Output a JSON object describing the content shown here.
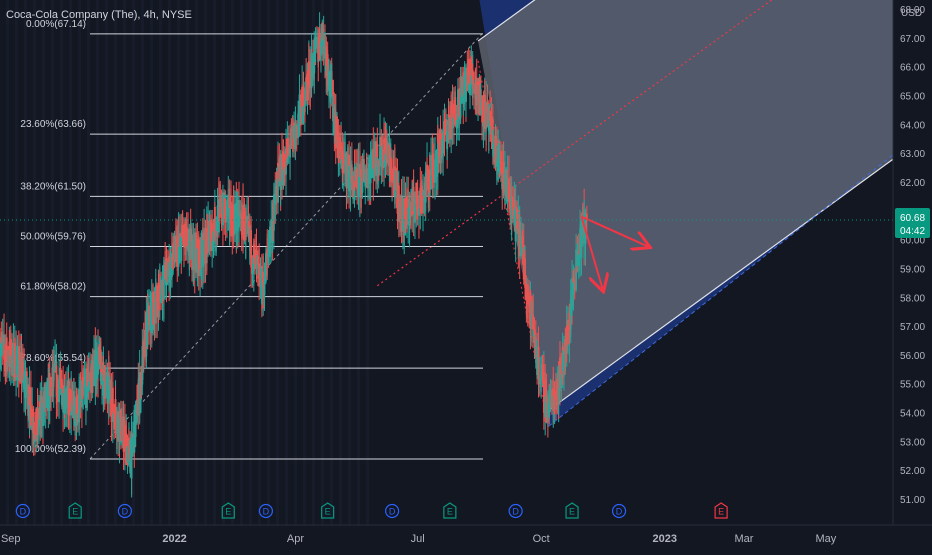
{
  "header": {
    "symbol_title": "Coca-Cola Company (The), 4h, NYSE",
    "currency": "USD"
  },
  "price_badge": {
    "price": "60.68",
    "countdown": "04:42",
    "color": "#089981"
  },
  "colors": {
    "background": "#131722",
    "candle_up": "#26a69a",
    "candle_down": "#ef5350",
    "fib_line": "#d1d4dc",
    "channel_outer": "#1e3a8a",
    "channel_inner": "#5d606b",
    "red_arrow": "#f23645",
    "event_dividend": "#2962ff",
    "event_earnings": "#089981",
    "event_earnings_future": "#f23645"
  },
  "chart_data": {
    "type": "candlestick",
    "y_axis": {
      "range": [
        50.8,
        68.7
      ],
      "ticks": [
        "51.00",
        "52.00",
        "53.00",
        "54.00",
        "55.00",
        "56.00",
        "57.00",
        "58.00",
        "59.00",
        "60.00",
        "61.00",
        "62.00",
        "63.00",
        "64.00",
        "65.00",
        "66.00",
        "67.00",
        "68.00"
      ]
    },
    "x_axis": {
      "range": [
        "2021-08-24",
        "2023-06-20"
      ],
      "ticks": [
        {
          "label": "Sep",
          "date": "2021-09-01"
        },
        {
          "label": "2022",
          "date": "2022-01-01"
        },
        {
          "label": "Apr",
          "date": "2022-04-01"
        },
        {
          "label": "Jul",
          "date": "2022-07-01"
        },
        {
          "label": "Oct",
          "date": "2022-10-01"
        },
        {
          "label": "2023",
          "date": "2023-01-01"
        },
        {
          "label": "Mar",
          "date": "2023-03-01"
        },
        {
          "label": "May",
          "date": "2023-05-01"
        }
      ]
    },
    "price_path": [
      [
        "2021-08-24",
        56.2
      ],
      [
        "2021-09-08",
        55.7
      ],
      [
        "2021-09-20",
        53.4
      ],
      [
        "2021-10-04",
        55.2
      ],
      [
        "2021-10-20",
        54.0
      ],
      [
        "2021-11-05",
        55.8
      ],
      [
        "2021-11-22",
        53.5
      ],
      [
        "2021-11-30",
        52.4
      ],
      [
        "2021-12-12",
        57.0
      ],
      [
        "2021-12-26",
        58.8
      ],
      [
        "2022-01-07",
        60.0
      ],
      [
        "2022-01-20",
        59.4
      ],
      [
        "2022-02-05",
        61.0
      ],
      [
        "2022-02-22",
        60.6
      ],
      [
        "2022-03-08",
        58.2
      ],
      [
        "2022-03-20",
        62.2
      ],
      [
        "2022-03-31",
        63.5
      ],
      [
        "2022-04-12",
        65.8
      ],
      [
        "2022-04-22",
        67.14
      ],
      [
        "2022-05-04",
        63.0
      ],
      [
        "2022-05-16",
        61.8
      ],
      [
        "2022-05-26",
        62.5
      ],
      [
        "2022-06-08",
        63.2
      ],
      [
        "2022-06-20",
        60.8
      ],
      [
        "2022-07-05",
        61.5
      ],
      [
        "2022-07-20",
        63.5
      ],
      [
        "2022-07-28",
        64.3
      ],
      [
        "2022-08-10",
        65.8
      ],
      [
        "2022-08-20",
        64.5
      ],
      [
        "2022-09-01",
        62.5
      ],
      [
        "2022-09-16",
        60.0
      ],
      [
        "2022-09-28",
        56.0
      ],
      [
        "2022-10-06",
        54.1
      ],
      [
        "2022-10-14",
        55.0
      ],
      [
        "2022-10-21",
        56.6
      ],
      [
        "2022-10-28",
        59.5
      ],
      [
        "2022-11-04",
        60.7
      ]
    ],
    "fibonacci": [
      {
        "label": "0.00%(67.14)",
        "price": 67.14
      },
      {
        "label": "23.60%(63.66)",
        "price": 63.66
      },
      {
        "label": "38.20%(61.50)",
        "price": 61.5
      },
      {
        "label": "50.00%(59.76)",
        "price": 59.76
      },
      {
        "label": "61.80%(58.02)",
        "price": 58.02
      },
      {
        "label": "78.60%(55.54)",
        "price": 55.54
      },
      {
        "label": "100.00%(52.39)",
        "price": 52.39
      }
    ],
    "current_price": 60.68,
    "current_price_date": "2022-11-04",
    "pitchfork": {
      "anchors": {
        "pivot": [
          "2022-06-01",
          58.4
        ],
        "high": [
          "2022-08-15",
          66.2
        ],
        "low": [
          "2022-10-05",
          53.8
        ]
      },
      "median_end": [
        "2023-04-05",
        68.8
      ],
      "inner_upper": [
        "2023-06-20",
        68.2
      ],
      "inner_lower": [
        "2023-06-20",
        67.2
      ],
      "outer_upper_top": [
        "2022-11-10",
        68.7
      ]
    },
    "arrows": [
      {
        "from": [
          "2022-10-31",
          60.8
        ],
        "to": [
          "2022-12-20",
          59.75
        ]
      },
      {
        "from": [
          "2022-10-31",
          60.8
        ],
        "to": [
          "2022-11-16",
          58.25
        ]
      }
    ],
    "events": [
      {
        "type": "D",
        "date": "2021-09-10"
      },
      {
        "type": "E",
        "date": "2021-10-19"
      },
      {
        "type": "D",
        "date": "2021-11-25"
      },
      {
        "type": "E",
        "date": "2022-02-10"
      },
      {
        "type": "D",
        "date": "2022-03-10"
      },
      {
        "type": "E",
        "date": "2022-04-25"
      },
      {
        "type": "D",
        "date": "2022-06-12"
      },
      {
        "type": "E",
        "date": "2022-07-25"
      },
      {
        "type": "D",
        "date": "2022-09-12"
      },
      {
        "type": "E",
        "date": "2022-10-24"
      },
      {
        "type": "D",
        "date": "2022-11-28"
      },
      {
        "type": "E",
        "date": "2023-02-12",
        "future": true
      }
    ]
  }
}
